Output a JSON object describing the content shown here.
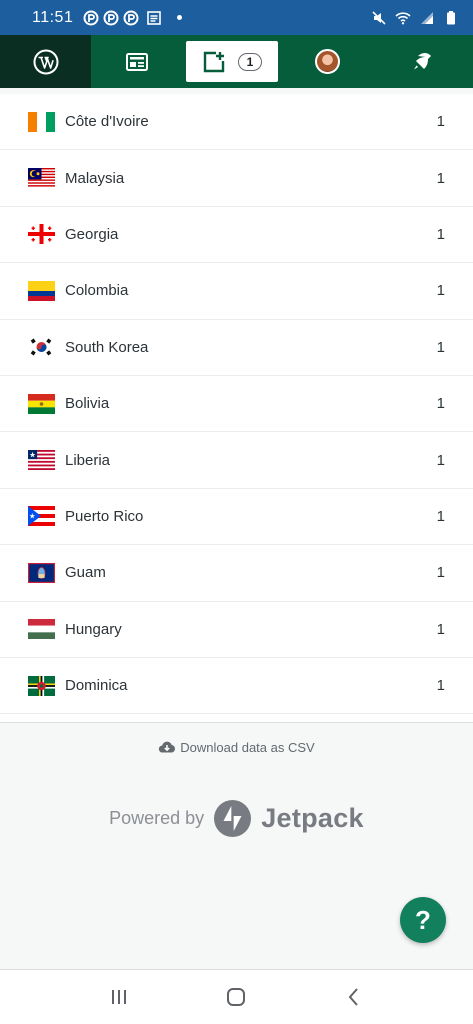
{
  "status_bar": {
    "time": "11:51",
    "left_icons": [
      "p-icon",
      "p-icon",
      "p-icon",
      "note-icon"
    ],
    "right_icons": [
      "mute-icon",
      "wifi-icon",
      "signal-icon",
      "battery-icon"
    ]
  },
  "nav": {
    "tabs": [
      {
        "name": "wordpress-logo-icon"
      },
      {
        "name": "reader-icon"
      },
      {
        "name": "write-post-icon",
        "badge": "1"
      },
      {
        "name": "avatar"
      },
      {
        "name": "notifications-icon"
      }
    ],
    "accent": "#065d3b"
  },
  "countries": [
    {
      "name": "Côte d'Ivoire",
      "count": "1"
    },
    {
      "name": "Malaysia",
      "count": "1"
    },
    {
      "name": "Georgia",
      "count": "1"
    },
    {
      "name": "Colombia",
      "count": "1"
    },
    {
      "name": "South Korea",
      "count": "1"
    },
    {
      "name": "Bolivia",
      "count": "1"
    },
    {
      "name": "Liberia",
      "count": "1"
    },
    {
      "name": "Puerto Rico",
      "count": "1"
    },
    {
      "name": "Guam",
      "count": "1"
    },
    {
      "name": "Hungary",
      "count": "1"
    },
    {
      "name": "Dominica",
      "count": "1"
    }
  ],
  "footer": {
    "download_label": "Download data as CSV",
    "powered_by": "Powered by",
    "brand": "Jetpack"
  },
  "help_button": {
    "label": "?",
    "color": "#12805c"
  }
}
